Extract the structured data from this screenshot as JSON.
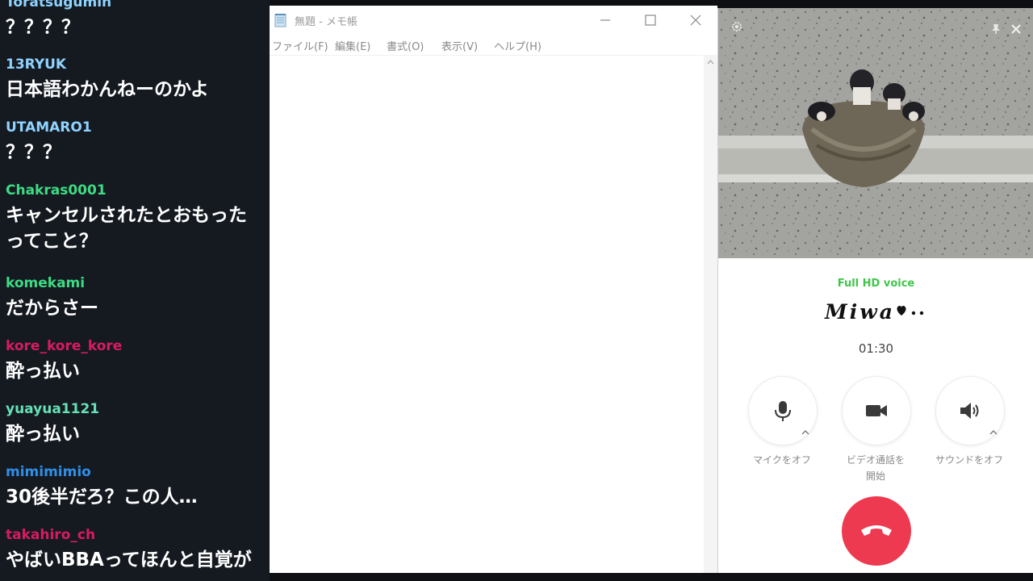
{
  "chat": {
    "messages": [
      {
        "user": "Toratsugumin",
        "text": "？？？？",
        "color": "#8fd3ff"
      },
      {
        "user": "13RYUK",
        "text": "日本語わかんねーのかよ",
        "color": "#8fd3ff"
      },
      {
        "user": "UTAMARO1",
        "text": "？？？",
        "color": "#8fd3ff"
      },
      {
        "user": "Chakras0001",
        "text": "キャンセルされたとおもった",
        "text2": "ってこと？",
        "color": "#3ddc84"
      },
      {
        "user": "komekami",
        "text": "だからさー",
        "color": "#3ddc84"
      },
      {
        "user": "kore_kore_kore",
        "text": "酔っ払い",
        "color": "#d81b60"
      },
      {
        "user": "yuayua1121",
        "text": "酔っ払い",
        "color": "#66e0b5"
      },
      {
        "user": "mimimimio",
        "text": "30後半だろ？この人…",
        "color": "#2f8fe8"
      },
      {
        "user": "takahiro_ch",
        "text": "やばいBBAってほんと自覚が",
        "color": "#d81b60"
      }
    ]
  },
  "notepad": {
    "title": "無題 - メモ帳",
    "menu": [
      "ファイル(F)",
      "編集(E)",
      "書式(O)",
      "表示(V)",
      "ヘルプ(H)"
    ],
    "content": ""
  },
  "call": {
    "quality": "Full HD voice",
    "name": "Miwa",
    "timer": "01:30",
    "buttons": [
      {
        "label": "マイクをオフ",
        "icon": "microphone-icon"
      },
      {
        "label": "ビデオ通話を",
        "label2": "開始",
        "icon": "video-camera-icon"
      },
      {
        "label": "サウンドをオフ",
        "icon": "speaker-icon"
      }
    ],
    "hangup_color": "#ee3a50",
    "quality_color": "#3fc54a"
  }
}
